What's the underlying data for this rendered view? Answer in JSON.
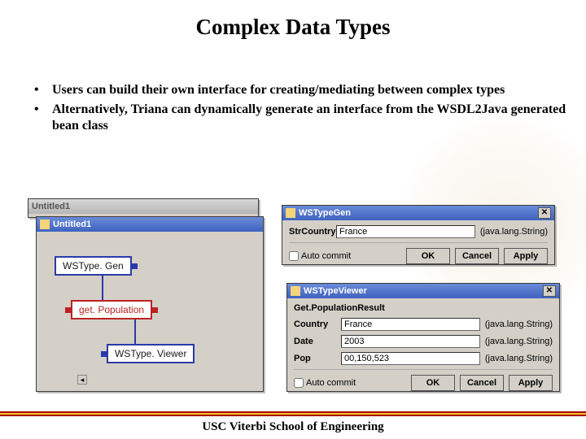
{
  "title": "Complex Data Types",
  "bullets": [
    "Users can build their own interface for creating/mediating between complex types",
    "Alternatively, Triana can dynamically generate an interface from the WSDL2Java generated bean class"
  ],
  "bgWindows": {
    "outer": "Untitled1",
    "inner": "Untitled1"
  },
  "nodes": {
    "wstypegen": "WSType. Gen",
    "getpop": "get. Population",
    "wstypeviewer": "WSType. Viewer"
  },
  "typeGen": {
    "title": "WSTypeGen",
    "fieldLabel": "StrCountry",
    "fieldValue": "France",
    "fieldType": "(java.lang.String)",
    "autoCommit": "Auto commit",
    "ok": "OK",
    "cancel": "Cancel",
    "apply": "Apply"
  },
  "typeViewer": {
    "title": "WSTypeViewer",
    "header": "Get.PopulationResult",
    "rows": [
      {
        "label": "Country",
        "value": "France",
        "type": "(java.lang.String)"
      },
      {
        "label": "Date",
        "value": "2003",
        "type": "(java.lang.String)"
      },
      {
        "label": "Pop",
        "value": "00,150,523",
        "type": "(java.lang.String)"
      }
    ],
    "autoCommit": "Auto commit",
    "ok": "OK",
    "cancel": "Cancel",
    "apply": "Apply"
  },
  "footer": "USC Viterbi School of Engineering"
}
